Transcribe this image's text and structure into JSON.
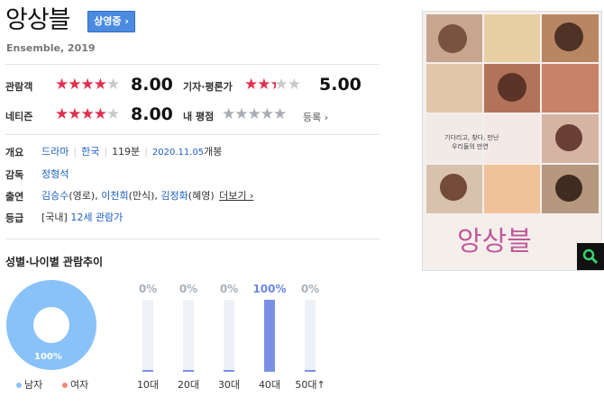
{
  "movie": {
    "title": "앙상블",
    "badge": "상영중 ›",
    "subtitle": "Ensemble, 2019"
  },
  "ratings": {
    "audience_label": "관람객",
    "audience_score": "8.00",
    "audience_stars": 4,
    "critic_label": "기자·평론가",
    "critic_score": "5.00",
    "critic_stars": 2.5,
    "netizen_label": "네티즌",
    "netizen_score": "8.00",
    "netizen_stars": 4,
    "my_label": "내 평점",
    "register_label": "등록 ›"
  },
  "info": {
    "overview_label": "개요",
    "genre": "드라마",
    "country": "한국",
    "runtime": "119분",
    "release_date": "2020.11.05",
    "release_suffix": "개봉",
    "director_label": "감독",
    "director": "정형석",
    "cast_label": "출연",
    "cast": [
      "김승수",
      "(영로), ",
      "이천희",
      "(만식), ",
      "김정화",
      "(혜영)"
    ],
    "more_label": "더보기 ›",
    "rating_label": "등급",
    "rating_prefix": "[국내]",
    "rating_value": "12세 관람가"
  },
  "trend": {
    "title": "성별·나이별 관람추이",
    "male_pct": "100%",
    "male_label": "남자",
    "female_label": "여자",
    "colors": {
      "male": "#88c2f8",
      "female": "#f48a72",
      "bar": "#7a8fe6"
    },
    "ages": [
      {
        "label": "10대",
        "pct": "0%",
        "value": 0
      },
      {
        "label": "20대",
        "pct": "0%",
        "value": 0
      },
      {
        "label": "30대",
        "pct": "0%",
        "value": 0
      },
      {
        "label": "40대",
        "pct": "100%",
        "value": 100
      },
      {
        "label": "50대↑",
        "pct": "0%",
        "value": 0
      }
    ]
  },
  "poster": {
    "tagline_1": "기다리고, 찾다, 만난",
    "tagline_2": "우리들의 만연",
    "title_script": "앙상블",
    "zoom_icon": "magnifier-icon"
  }
}
